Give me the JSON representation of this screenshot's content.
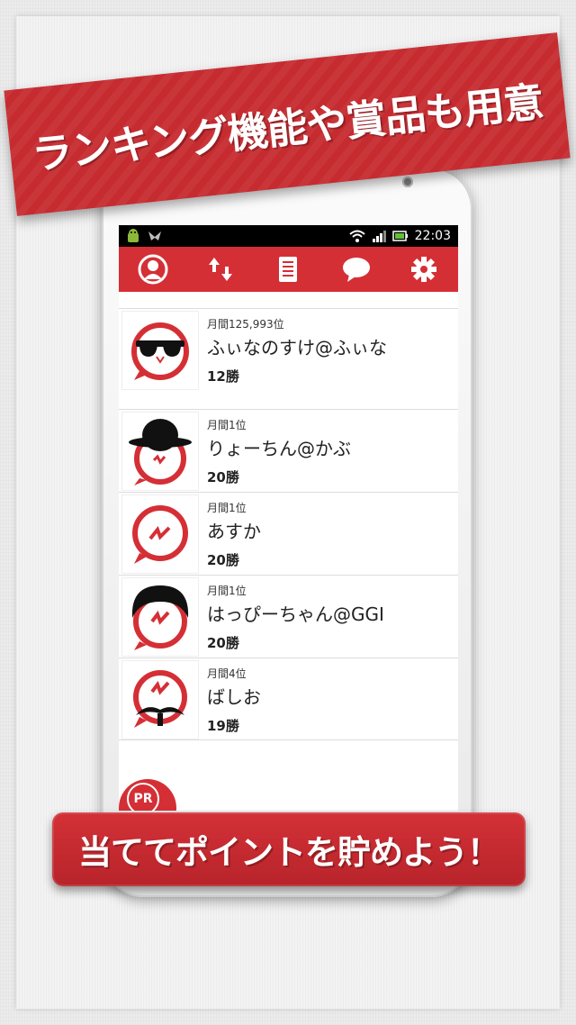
{
  "banner_top": "ランキング機能や賞品も用意",
  "banner_bottom": "当ててポイントを貯めよう！",
  "status_bar": {
    "time": "22:03"
  },
  "toolbar": {
    "icons": [
      "profile-icon",
      "sort-icon",
      "list-icon",
      "chat-icon",
      "settings-icon"
    ]
  },
  "ranking": [
    {
      "rank": "月間125,993位",
      "name": "ふぃなのすけ@ふぃな",
      "wins": "12勝",
      "avatar": "sunglasses"
    },
    {
      "rank": "月間1位",
      "name": "りょーちん@かぶ",
      "wins": "20勝",
      "avatar": "hat"
    },
    {
      "rank": "月間1位",
      "name": "あすか",
      "wins": "20勝",
      "avatar": "plain"
    },
    {
      "rank": "月間1位",
      "name": "はっぴーちゃん@GGI",
      "wins": "20勝",
      "avatar": "hair"
    },
    {
      "rank": "月間4位",
      "name": "ばしお",
      "wins": "19勝",
      "avatar": "mustache"
    }
  ],
  "pr_label": "PR",
  "colors": {
    "accent": "#d52f36",
    "banner": "#c62b30"
  }
}
